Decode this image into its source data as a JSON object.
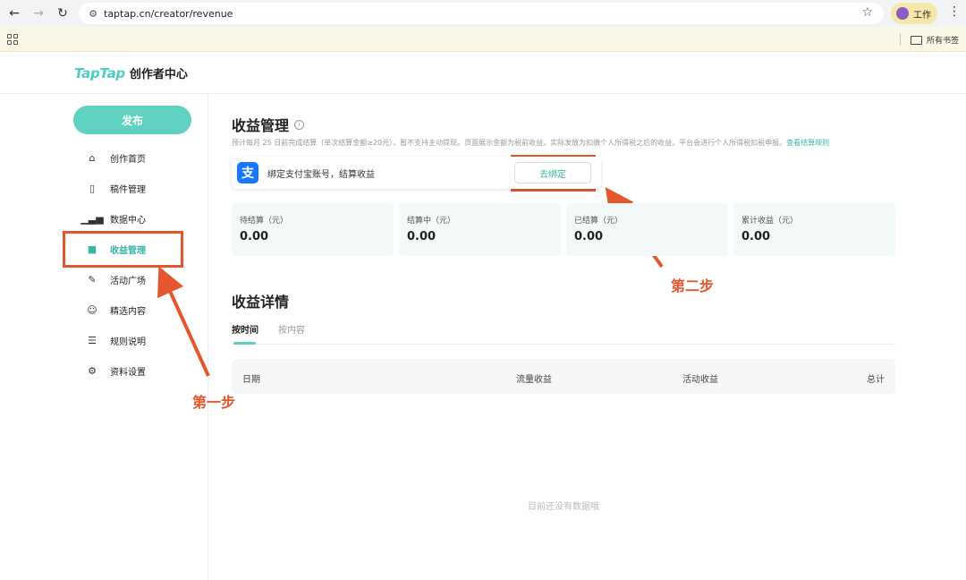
{
  "browser": {
    "url": "taptap.cn/creator/revenue",
    "profile_label": "工作",
    "bookmarks_folder": "所有书签"
  },
  "header": {
    "brand": "TapTap",
    "subtitle": "创作者中心"
  },
  "sidebar": {
    "publish_label": "发布",
    "items": [
      {
        "label": "创作首页",
        "icon": "home-icon"
      },
      {
        "label": "稿件管理",
        "icon": "document-icon"
      },
      {
        "label": "数据中心",
        "icon": "bar-chart-icon"
      },
      {
        "label": "收益管理",
        "icon": "folder-icon",
        "active": true
      },
      {
        "label": "活动广场",
        "icon": "party-icon"
      },
      {
        "label": "精选内容",
        "icon": "featured-icon"
      },
      {
        "label": "规则说明",
        "icon": "rules-icon"
      },
      {
        "label": "资料设置",
        "icon": "settings-icon"
      }
    ]
  },
  "annotations": {
    "step1": "第一步",
    "step2": "第二步",
    "color": "#e4572e"
  },
  "main": {
    "title": "收益管理",
    "notice": "预计每月 25 日前完成结算（单次结算金额≥20元），暂不支持主动提现。页面展示金额为税前收益，实际发放为扣缴个人所得税之后的收益，平台会进行个人所得税扣税申报。",
    "notice_link": "查看结算规则",
    "bind": {
      "text": "绑定支付宝账号，结算收益",
      "button": "去绑定",
      "alipay_glyph": "支"
    },
    "stats": [
      {
        "label": "待结算（元）",
        "value": "0.00"
      },
      {
        "label": "结算中（元）",
        "value": "0.00"
      },
      {
        "label": "已结算（元）",
        "value": "0.00"
      },
      {
        "label": "累计收益（元）",
        "value": "0.00"
      }
    ],
    "detail_title": "收益详情",
    "tabs": [
      "按时间",
      "按内容"
    ],
    "table_headers": [
      "日期",
      "流量收益",
      "活动收益",
      "总计"
    ],
    "empty_text": "目前还没有数据哦"
  },
  "colors": {
    "accent": "#5fd1c0",
    "accent_text": "#36b6a8",
    "alipay": "#1677ff"
  }
}
